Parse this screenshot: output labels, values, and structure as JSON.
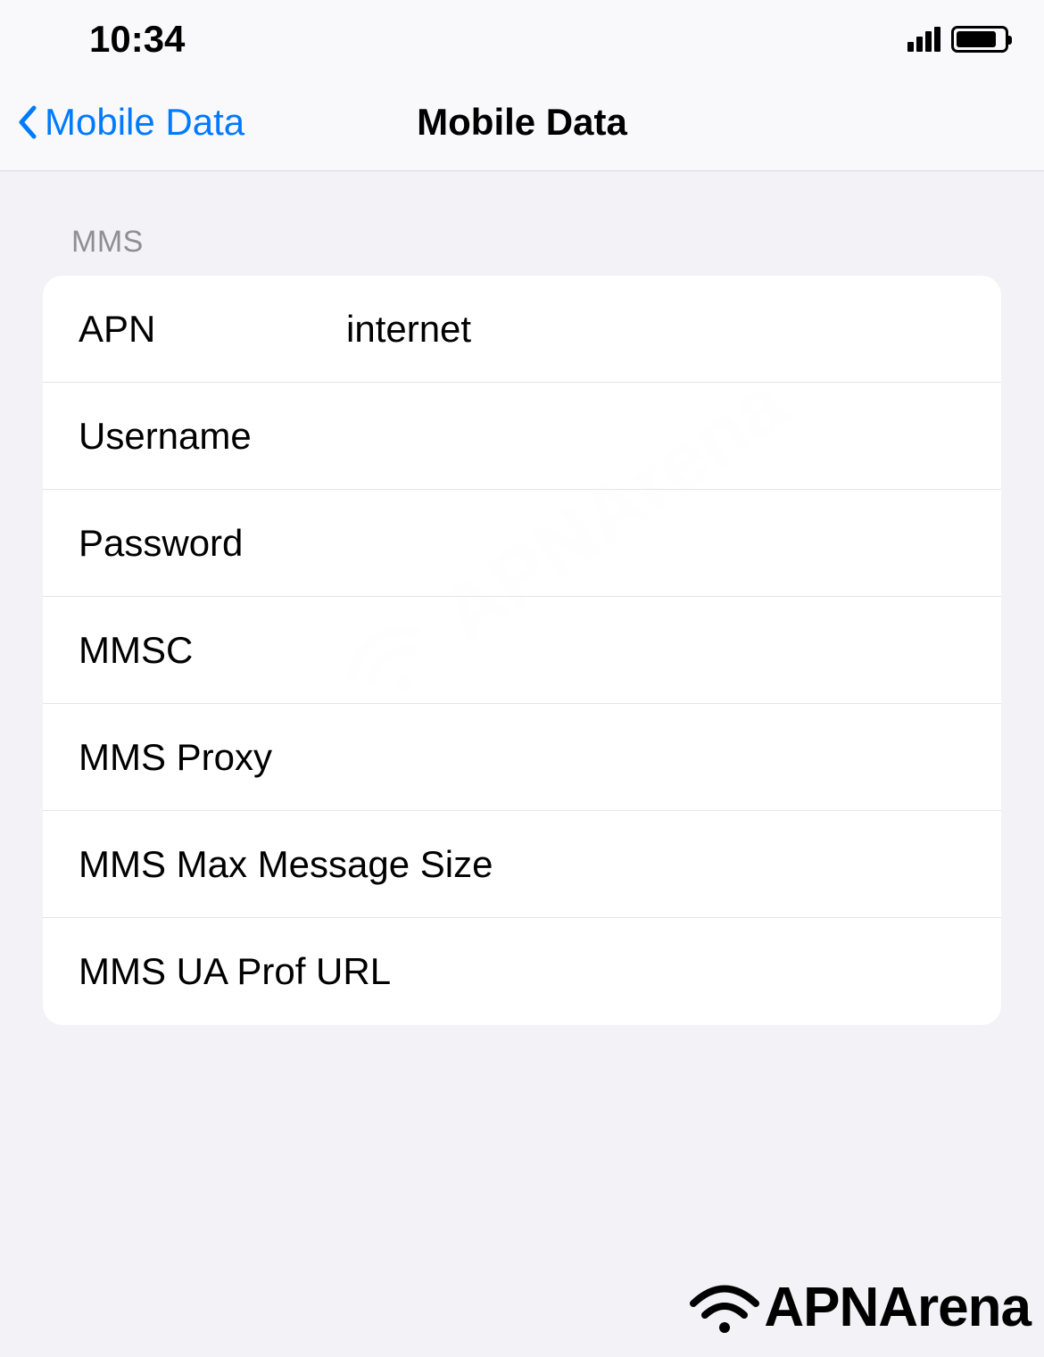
{
  "status": {
    "time": "10:34"
  },
  "nav": {
    "back_label": "Mobile Data",
    "title": "Mobile Data"
  },
  "section_header": "MMS",
  "fields": {
    "apn": {
      "label": "APN",
      "value": "internet"
    },
    "username": {
      "label": "Username",
      "value": ""
    },
    "password": {
      "label": "Password",
      "value": ""
    },
    "mmsc": {
      "label": "MMSC",
      "value": ""
    },
    "mms_proxy": {
      "label": "MMS Proxy",
      "value": ""
    },
    "mms_max_size": {
      "label": "MMS Max Message Size",
      "value": ""
    },
    "mms_ua_prof": {
      "label": "MMS UA Prof URL",
      "value": ""
    }
  },
  "watermark": {
    "text": "APNArena"
  }
}
